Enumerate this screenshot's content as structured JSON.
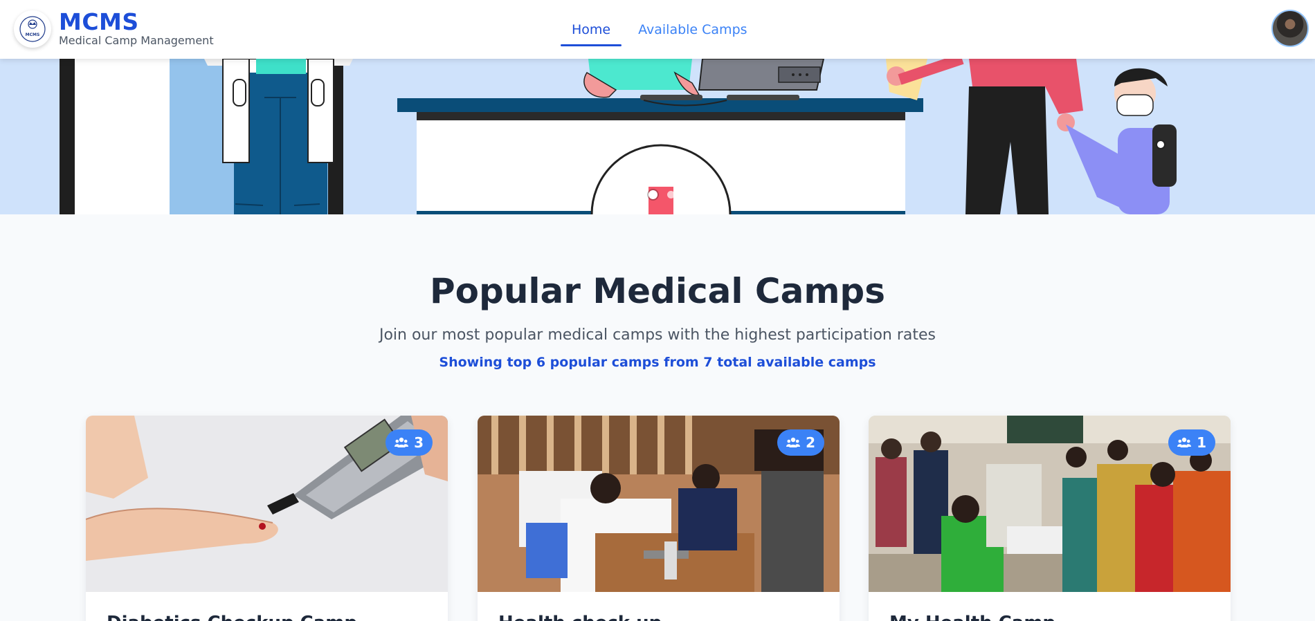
{
  "header": {
    "brand_title": "MCMS",
    "brand_subtitle": "Medical Camp Management",
    "logo_text": "MCMS",
    "nav": [
      {
        "label": "Home",
        "active": true
      },
      {
        "label": "Available Camps",
        "active": false
      }
    ]
  },
  "hero": {
    "slide_count": 3,
    "active_slide": 2
  },
  "section": {
    "title": "Popular Medical Camps",
    "subtitle": "Join our most popular medical camps with the highest participation rates",
    "meta": "Showing top 6 popular camps from 7 total available camps"
  },
  "cards": [
    {
      "participants": "3",
      "title": "Diabetics Checkup Camp",
      "image": "glucose-meter-photo"
    },
    {
      "participants": "2",
      "title": "Health check up",
      "image": "blood-pressure-check-photo"
    },
    {
      "participants": "1",
      "title": "My Health Camp",
      "image": "village-health-camp-photo"
    }
  ],
  "colors": {
    "accent": "#1d4ed8",
    "link": "#3b82f6",
    "badge": "#3b82f6",
    "hero_bg": "#cfe2fb",
    "page_bg": "#f8fafc"
  },
  "icons": {
    "badge_icon": "users-icon",
    "logo": "crown-seal-icon"
  }
}
